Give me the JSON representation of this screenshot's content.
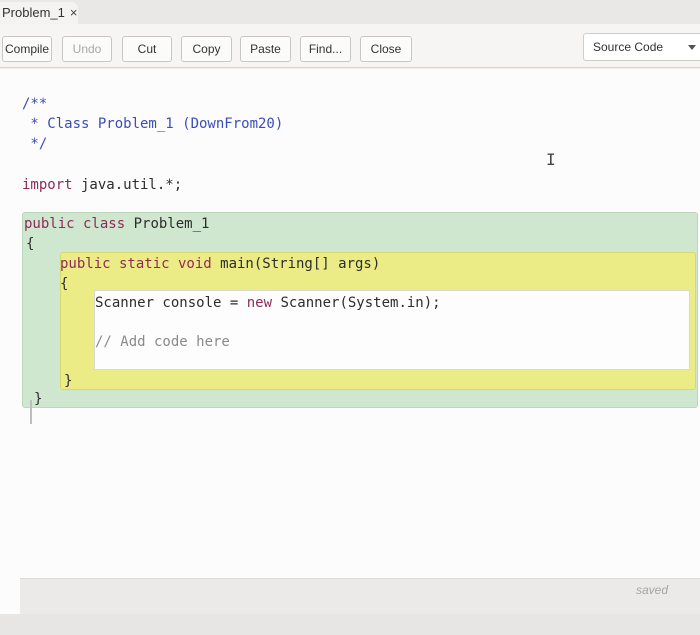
{
  "tab": {
    "title": "Problem_1",
    "close": "×"
  },
  "toolbar": {
    "compile": "Compile",
    "undo": "Undo",
    "cut": "Cut",
    "copy": "Copy",
    "paste": "Paste",
    "find": "Find...",
    "close": "Close",
    "view": "Source Code"
  },
  "code": {
    "line1": "/**",
    "line2": " * Class Problem_1 (DownFrom20)",
    "line3": " */",
    "import_kw": "import",
    "import_rest": " java.util.*;",
    "class_kw": "public class",
    "class_name": " Problem_1",
    "class_open": "{",
    "method_kw": "public static void",
    "method_sig": " main(String[] args)",
    "method_open": "{",
    "scanner_a": "Scanner console = ",
    "scanner_kw": "new",
    "scanner_b": " Scanner(System.in);",
    "todo": "// Add code here",
    "method_close": "}",
    "class_close": "}"
  },
  "status": {
    "saved": "saved"
  },
  "colors": {
    "class_scope": "#cfe6cf",
    "method_scope": "#ecec86",
    "keyword": "#8e2a5a",
    "comment": "#3b4db8"
  }
}
